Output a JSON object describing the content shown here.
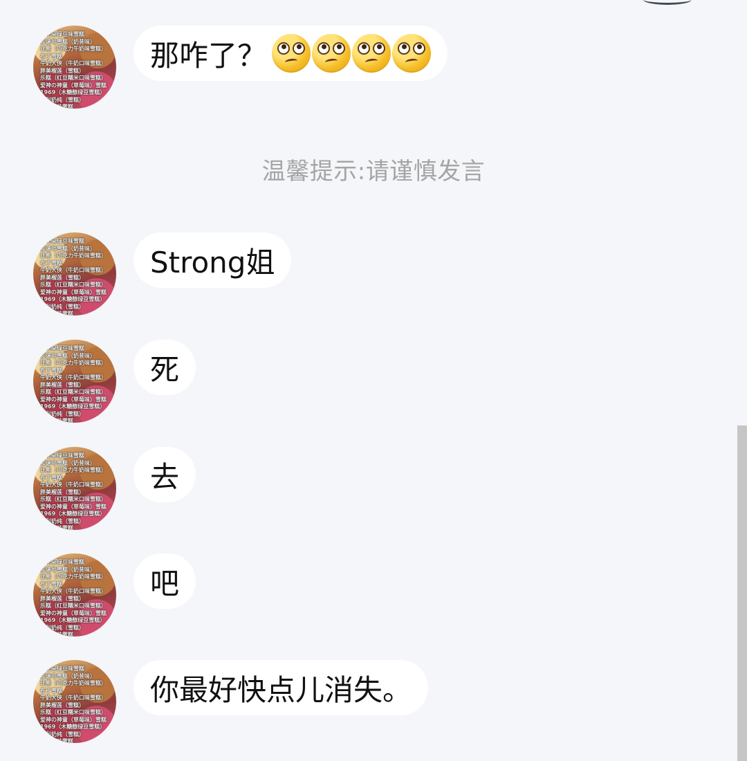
{
  "avatar": {
    "caption_lines": [
      "小花朵绿豆味雪糕",
      "和谐号雪糕（奶昔味）",
      "比熊（巧克力牛奶味雪糕）",
      "布丁雪糕",
      "牛奶大侠（牛奶口味雪糕）",
      "胖美榴莲（雪糕）",
      "乐糕（红豆糯米口味雪糕）",
      "爱神の神童（草莓味）雪糕",
      "1969（木糖醇绿豆雪糕）",
      "大利奶纯（雪糕）",
      "草莓口味雪糕"
    ]
  },
  "messages": [
    {
      "text": "那咋了？",
      "emoji_count": 4,
      "emoji_name": "face-with-rolling-eyes-icon"
    },
    {
      "text": "Strong姐"
    },
    {
      "text": "死"
    },
    {
      "text": "去"
    },
    {
      "text": "吧"
    },
    {
      "text": "你最好快点儿消失。"
    }
  ],
  "system_tip": "温馨提示:请谨慎发言",
  "colors": {
    "background": "#f4f6f9",
    "bubble": "#ffffff",
    "tip_text": "#a5a5a5",
    "scrollbar": "#c6c6c6"
  }
}
